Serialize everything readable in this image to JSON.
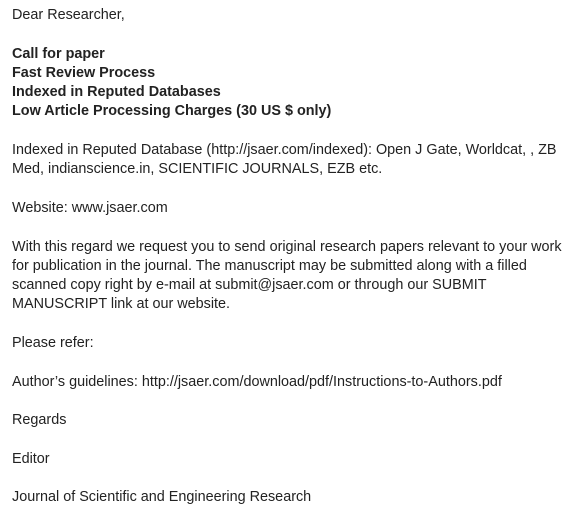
{
  "greeting": "Dear Researcher,",
  "highlights": [
    "Call for paper",
    "Fast Review Process",
    "Indexed in Reputed Databases",
    "Low Article Processing Charges (30 US $ only)"
  ],
  "indexed": {
    "line1": "Indexed in Reputed Database (http://jsaer.com/indexed): Open J Gate, Worldcat, , ZB",
    "line2": "Med, indianscience.in, SCIENTIFIC JOURNALS, EZB etc."
  },
  "website": "Website:  www.jsaer.com",
  "request": {
    "line1": "With this regard we request you to send original research papers relevant to your work",
    "line2": "for publication in the journal. The manuscript may be submitted along with a filled",
    "line3": "scanned copy right by e-mail at submit@jsaer.com or through our SUBMIT",
    "line4": "MANUSCRIPT link at our website."
  },
  "please_refer": "Please refer:",
  "guidelines": "Author’s guidelines: http://jsaer.com/download/pdf/Instructions-to-Authors.pdf",
  "regards": "Regards",
  "editor": "Editor",
  "journal": "Journal of Scientific and Engineering Research"
}
